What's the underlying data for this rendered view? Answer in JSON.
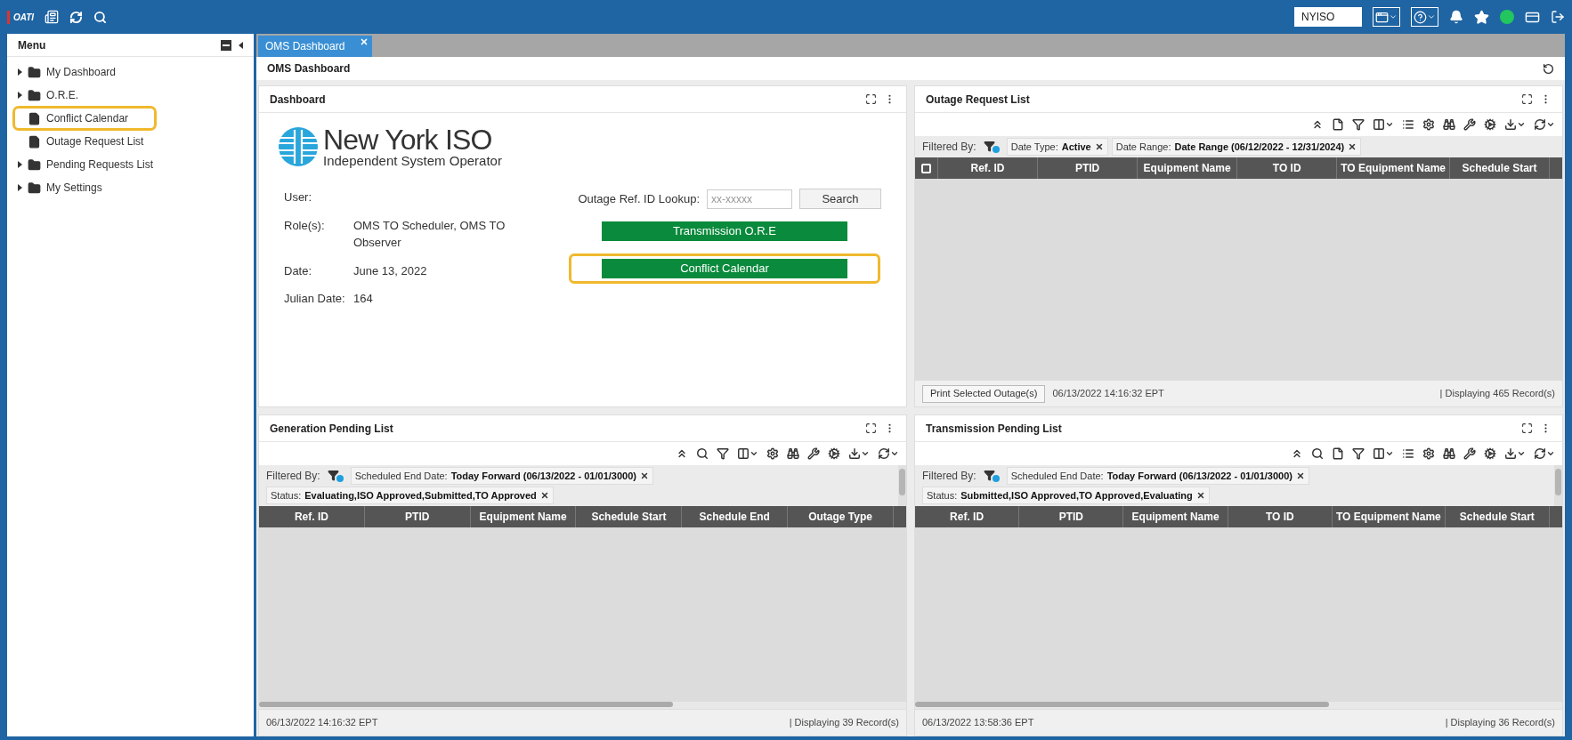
{
  "topbar": {
    "logo": "OATI",
    "entity": "NYISO"
  },
  "sidebar": {
    "title": "Menu",
    "items": [
      {
        "label": "My Dashboard",
        "kind": "folder",
        "expanded": false,
        "highlighted": false
      },
      {
        "label": "O.R.E.",
        "kind": "folder",
        "expanded": false,
        "highlighted": false
      },
      {
        "label": "Conflict Calendar",
        "kind": "page",
        "highlighted": true
      },
      {
        "label": "Outage Request List",
        "kind": "page",
        "highlighted": false
      },
      {
        "label": "Pending Requests List",
        "kind": "folder",
        "expanded": false,
        "highlighted": false
      },
      {
        "label": "My Settings",
        "kind": "folder",
        "expanded": false,
        "highlighted": false
      }
    ]
  },
  "tabs": [
    {
      "label": "OMS Dashboard",
      "selected": true
    }
  ],
  "page_title": "OMS Dashboard",
  "dashboard": {
    "title": "Dashboard",
    "logo_name": "New York ISO",
    "logo_tagline": "Independent System Operator",
    "info": [
      {
        "label": "User:"
      },
      {
        "label": "Role(s):",
        "value": "OMS TO Scheduler, OMS TO Observer"
      },
      {
        "label": "Date:",
        "value": "June 13, 2022"
      },
      {
        "label": "Julian Date:",
        "value": "164"
      }
    ],
    "lookup_label": "Outage Ref. ID Lookup:",
    "lookup_placeholder": "xx-xxxxx",
    "search_button": "Search",
    "buttons": [
      {
        "label": "Transmission O.R.E",
        "highlighted": false
      },
      {
        "label": "Conflict Calendar",
        "highlighted": true
      }
    ]
  },
  "lists": [
    {
      "kind": "outage",
      "title": "Outage Request List",
      "filter_label": "Filtered By:",
      "filters": [
        {
          "label": "Date Type:",
          "value": "Active"
        },
        {
          "label": "Date Range:",
          "value": "Date Range (06/12/2022 - 12/31/2024)"
        }
      ],
      "select_all_checked": false,
      "columns": [
        "Ref. ID",
        "PTID",
        "Equipment Name",
        "TO ID",
        "TO Equipment Name",
        "Schedule Start"
      ],
      "print_button": "Print Selected Outage(s)",
      "timestamp": "06/13/2022 14:16:32 EPT",
      "records": "| Displaying 465 Record(s)"
    },
    {
      "kind": "generation",
      "title": "Generation Pending List",
      "filter_label": "Filtered By:",
      "filters": [
        {
          "label": "Scheduled End Date:",
          "value": "Today Forward (06/13/2022 - 01/01/3000)"
        }
      ],
      "status_filter": {
        "label": "Status:",
        "value": "Evaluating,ISO Approved,Submitted,TO Approved"
      },
      "columns": [
        "Ref. ID",
        "PTID",
        "Equipment Name",
        "Schedule Start",
        "Schedule End",
        "Outage Type"
      ],
      "timestamp": "06/13/2022 14:16:32 EPT",
      "records": "| Displaying 39 Record(s)"
    },
    {
      "kind": "transmission",
      "title": "Transmission Pending List",
      "filter_label": "Filtered By:",
      "filters": [
        {
          "label": "Scheduled End Date:",
          "value": "Today Forward (06/13/2022 - 01/01/3000)"
        }
      ],
      "status_filter": {
        "label": "Status:",
        "value": "Submitted,ISO Approved,TO Approved,Evaluating"
      },
      "columns": [
        "Ref. ID",
        "PTID",
        "Equipment Name",
        "TO ID",
        "TO Equipment Name",
        "Schedule Start"
      ],
      "timestamp": "06/13/2022 13:58:36 EPT",
      "records": "| Displaying 36 Record(s)"
    }
  ]
}
